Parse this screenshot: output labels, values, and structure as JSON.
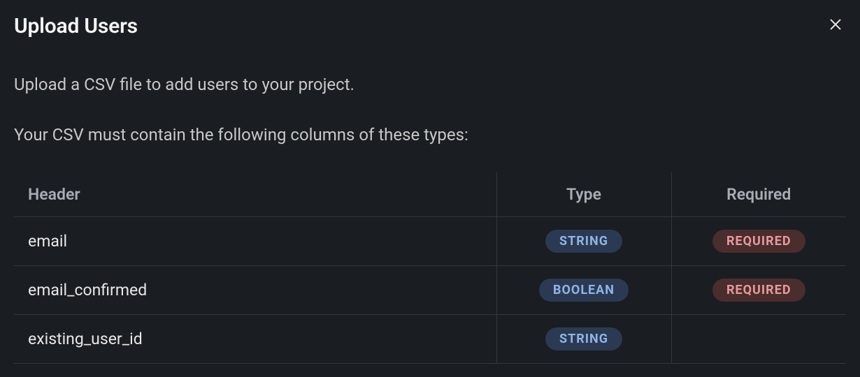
{
  "modal": {
    "title": "Upload Users",
    "description": "Upload a CSV file to add users to your project.",
    "subdescription": "Your CSV must contain the following columns of these types:"
  },
  "table": {
    "columns": {
      "header": "Header",
      "type": "Type",
      "required": "Required"
    },
    "rows": [
      {
        "header": "email",
        "type": "STRING",
        "type_kind": "string",
        "required": "REQUIRED"
      },
      {
        "header": "email_confirmed",
        "type": "BOOLEAN",
        "type_kind": "boolean",
        "required": "REQUIRED"
      },
      {
        "header": "existing_user_id",
        "type": "STRING",
        "type_kind": "string",
        "required": ""
      }
    ]
  }
}
